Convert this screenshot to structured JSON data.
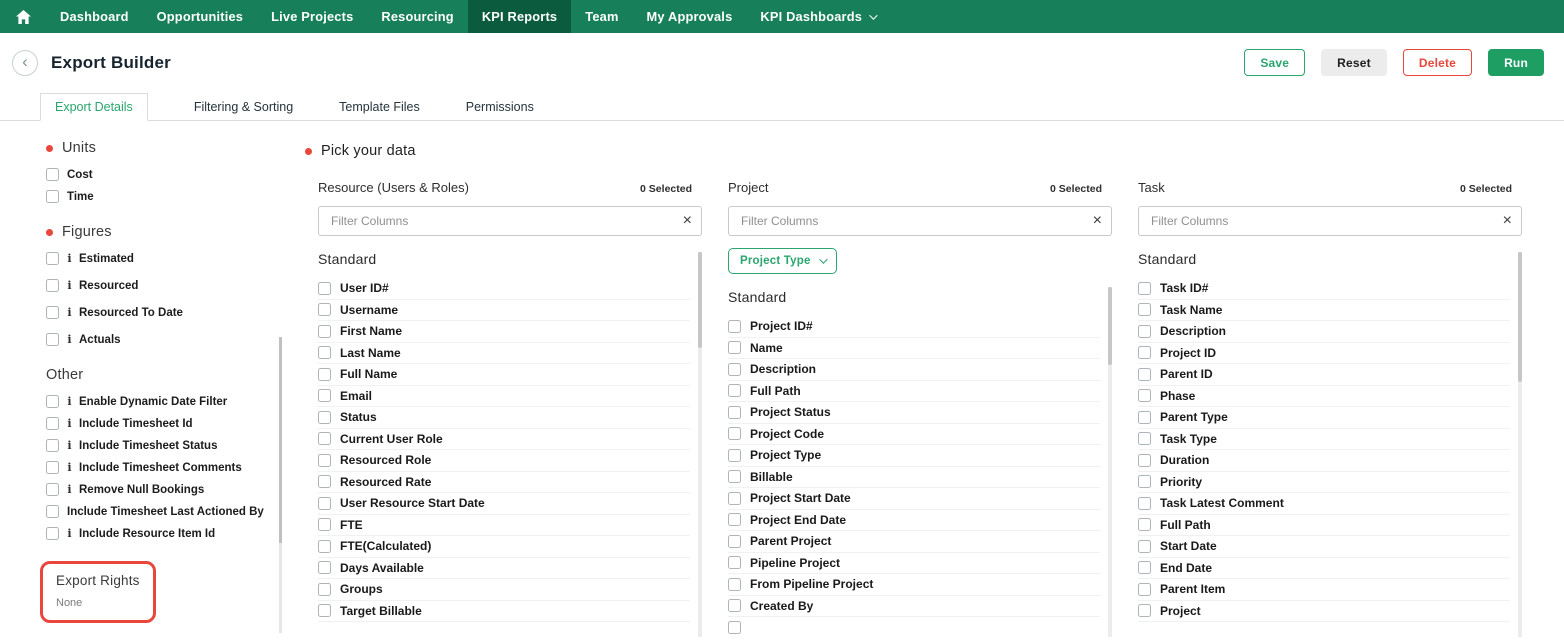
{
  "colors": {
    "nav_green": "#17805B",
    "nav_active_green": "#0B5C3F",
    "accent_green": "#2AA56D",
    "run_green": "#1E9E62",
    "alert_red": "#E8473B"
  },
  "icons": {
    "info": "i",
    "clear": "×",
    "back": "‹",
    "home": "home-icon",
    "chevron": "chevron-down-icon"
  },
  "navbar": {
    "items": [
      {
        "label": "Dashboard",
        "active": false,
        "dropdown": false
      },
      {
        "label": "Opportunities",
        "active": false,
        "dropdown": false
      },
      {
        "label": "Live Projects",
        "active": false,
        "dropdown": false
      },
      {
        "label": "Resourcing",
        "active": false,
        "dropdown": false
      },
      {
        "label": "KPI Reports",
        "active": true,
        "dropdown": false
      },
      {
        "label": "Team",
        "active": false,
        "dropdown": false
      },
      {
        "label": "My Approvals",
        "active": false,
        "dropdown": false
      },
      {
        "label": "KPI Dashboards",
        "active": false,
        "dropdown": true
      }
    ]
  },
  "header": {
    "title": "Export Builder",
    "buttons": [
      {
        "label": "Save",
        "style": "save"
      },
      {
        "label": "Reset",
        "style": "reset"
      },
      {
        "label": "Delete",
        "style": "delete"
      },
      {
        "label": "Run",
        "style": "run"
      }
    ]
  },
  "tabs": [
    {
      "label": "Export Details",
      "active": true
    },
    {
      "label": "Filtering & Sorting",
      "active": false
    },
    {
      "label": "Template Files",
      "active": false
    },
    {
      "label": "Permissions",
      "active": false
    }
  ],
  "sidebar": {
    "sections": [
      {
        "title": "Units",
        "dot": true,
        "spacing": "normal",
        "items": [
          {
            "label": "Cost",
            "info": false
          },
          {
            "label": "Time",
            "info": false
          }
        ]
      },
      {
        "title": "Figures",
        "dot": true,
        "spacing": "wide",
        "items": [
          {
            "label": "Estimated",
            "info": true
          },
          {
            "label": "Resourced",
            "info": true
          },
          {
            "label": "Resourced To Date",
            "info": true
          },
          {
            "label": "Actuals",
            "info": true
          }
        ]
      },
      {
        "title": "Other",
        "dot": false,
        "spacing": "normal",
        "items": [
          {
            "label": "Enable Dynamic Date Filter",
            "info": true
          },
          {
            "label": "Include Timesheet Id",
            "info": true
          },
          {
            "label": "Include Timesheet Status",
            "info": true
          },
          {
            "label": "Include Timesheet Comments",
            "info": true
          },
          {
            "label": "Remove Null Bookings",
            "info": true
          },
          {
            "label": "Include Timesheet Last Actioned By",
            "info": false
          },
          {
            "label": "Include Resource Item Id",
            "info": true
          }
        ]
      }
    ],
    "export_rights": {
      "title": "Export Rights",
      "value": "None"
    }
  },
  "main": {
    "title": "Pick your data",
    "columns": [
      {
        "title": "Resource (Users & Roles)",
        "selected": "0 Selected",
        "filter_placeholder": "Filter Columns",
        "chip": null,
        "group": "Standard",
        "items": [
          "User ID#",
          "Username",
          "First Name",
          "Last Name",
          "Full Name",
          "Email",
          "Status",
          "Current User Role",
          "Resourced Role",
          "Resourced Rate",
          "User Resource Start Date",
          "FTE",
          "FTE(Calculated)",
          "Days Available",
          "Groups",
          "Target Billable"
        ]
      },
      {
        "title": "Project",
        "selected": "0 Selected",
        "filter_placeholder": "Filter Columns",
        "chip": "Project Type",
        "group": "Standard",
        "items": [
          "Project ID#",
          "Name",
          "Description",
          "Full Path",
          "Project Status",
          "Project Code",
          "Project Type",
          "Billable",
          "Project Start Date",
          "Project End Date",
          "Parent Project",
          "Pipeline Project",
          "From Pipeline Project",
          "Created By",
          ""
        ]
      },
      {
        "title": "Task",
        "selected": "0 Selected",
        "filter_placeholder": "Filter Columns",
        "chip": null,
        "group": "Standard",
        "items": [
          "Task ID#",
          "Task Name",
          "Description",
          "Project ID",
          "Parent ID",
          "Phase",
          "Parent Type",
          "Task Type",
          "Duration",
          "Priority",
          "Task Latest Comment",
          "Full Path",
          "Start Date",
          "End Date",
          "Parent Item",
          "Project"
        ]
      }
    ]
  }
}
